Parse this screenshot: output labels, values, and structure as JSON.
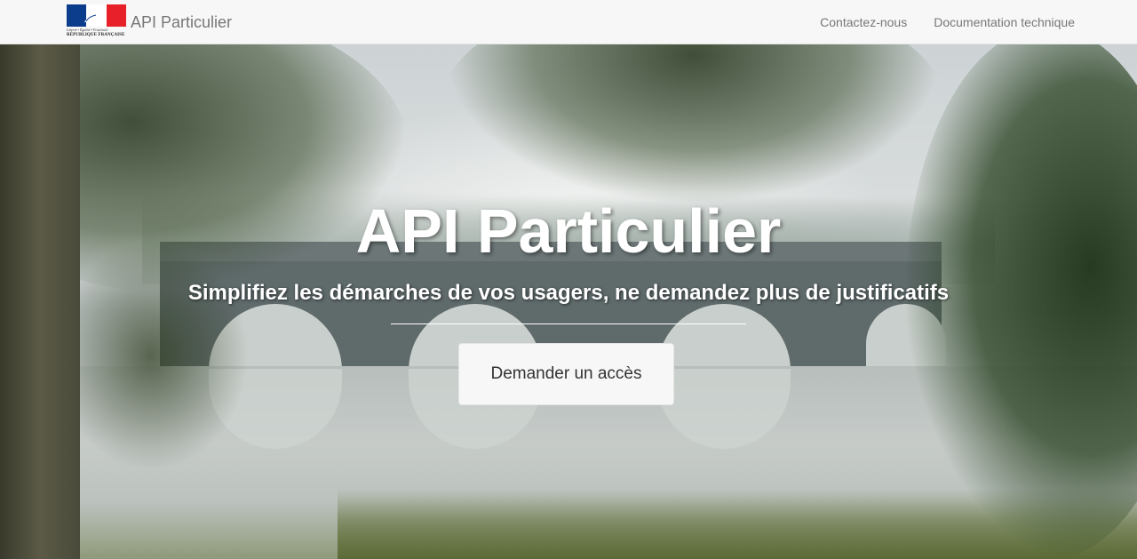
{
  "navbar": {
    "brand": {
      "logo_motto": "Liberté • Égalité • Fraternité",
      "logo_text": "RÉPUBLIQUE FRANÇAISE",
      "name": "API Particulier"
    },
    "links": [
      {
        "label": "Contactez-nous"
      },
      {
        "label": "Documentation technique"
      }
    ]
  },
  "hero": {
    "title": "API Particulier",
    "subtitle": "Simplifiez les démarches de vos usagers, ne demandez plus de justificatifs",
    "cta_label": "Demander un accès"
  },
  "colors": {
    "navbar_bg": "#f7f7f7",
    "nav_text": "#777777",
    "hero_text": "#ffffff",
    "button_bg": "#f7f7f7",
    "flag_blue": "#0c3c8c",
    "flag_red": "#e8202a"
  }
}
